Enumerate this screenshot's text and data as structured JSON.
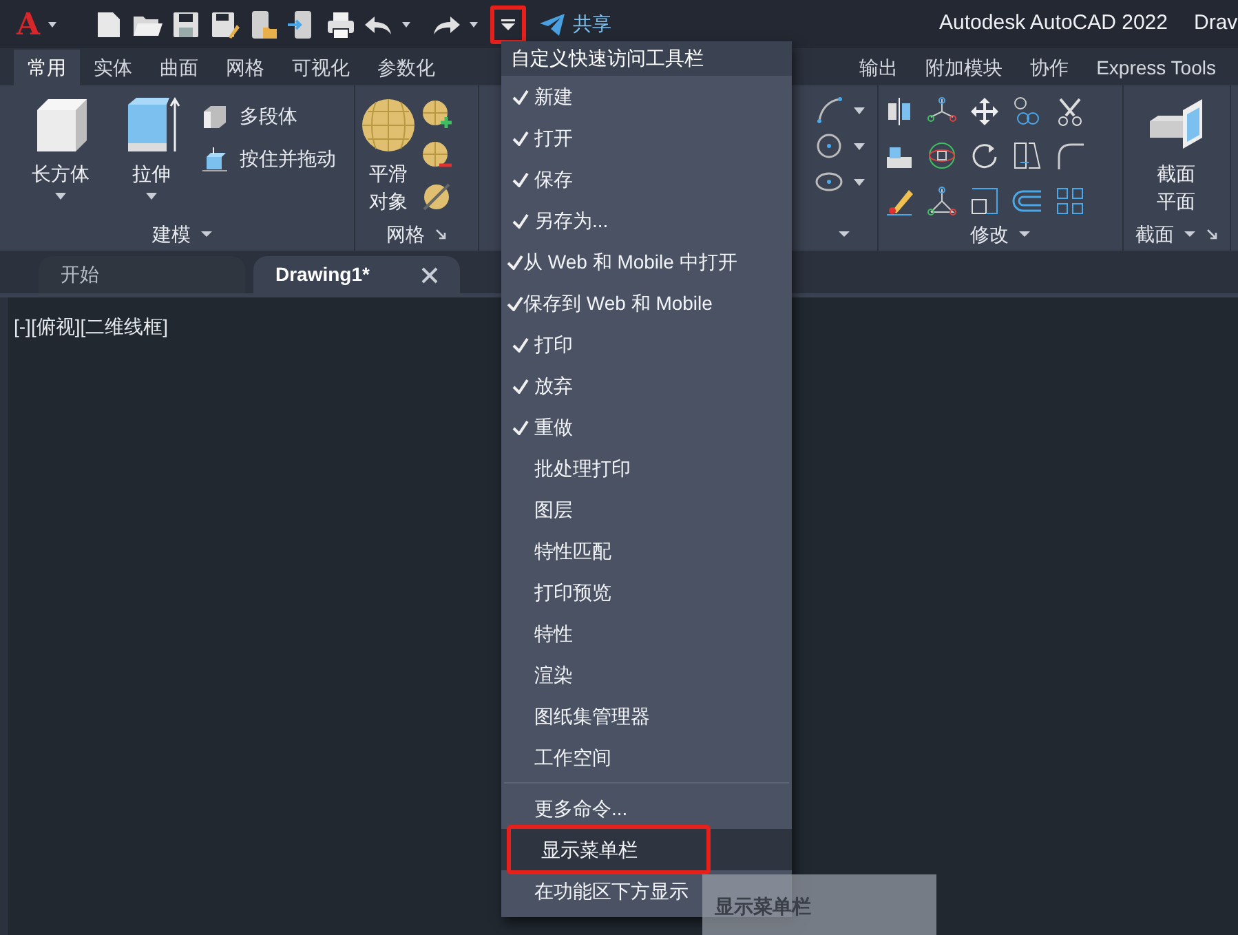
{
  "title_bar": {
    "logo_letter": "A",
    "share_label": "共享",
    "title": "Autodesk AutoCAD 2022",
    "title_cut": "Drav",
    "dropdown_highlighted": true
  },
  "ribbon_tabs": [
    {
      "label": "常用",
      "selected": true
    },
    {
      "label": "实体",
      "selected": false
    },
    {
      "label": "曲面",
      "selected": false
    },
    {
      "label": "网格",
      "selected": false
    },
    {
      "label": "可视化",
      "selected": false
    },
    {
      "label": "参数化",
      "selected": false
    },
    {
      "label": "输出",
      "selected": false
    },
    {
      "label": "附加模块",
      "selected": false
    },
    {
      "label": "协作",
      "selected": false
    },
    {
      "label": "Express Tools",
      "selected": false
    }
  ],
  "ribbon": {
    "modeling": {
      "title": "建模",
      "box": "长方体",
      "extrude": "拉伸",
      "polysolid": "多段体",
      "presspull": "按住并拖动"
    },
    "mesh": {
      "title": "网格",
      "smooth": "平滑对象"
    },
    "modify": {
      "title": "修改"
    },
    "section": {
      "title": "截面",
      "plane": "截面平面"
    }
  },
  "doc_tabs": [
    {
      "label": "开始",
      "selected": false
    },
    {
      "label": "Drawing1*",
      "selected": true
    }
  ],
  "viewport_label": "[-][俯视][二维线框]",
  "qat_menu": {
    "title": "自定义快速访问工具栏",
    "items": [
      {
        "kind": "command",
        "label": "新建",
        "checked": true,
        "selected": false,
        "highlighted": false
      },
      {
        "kind": "command",
        "label": "打开",
        "checked": true,
        "selected": false,
        "highlighted": false
      },
      {
        "kind": "command",
        "label": "保存",
        "checked": true,
        "selected": false,
        "highlighted": false
      },
      {
        "kind": "command",
        "label": "另存为...",
        "checked": true,
        "selected": false,
        "highlighted": false
      },
      {
        "kind": "command",
        "label": "从 Web 和 Mobile 中打开",
        "checked": true,
        "selected": false,
        "highlighted": false
      },
      {
        "kind": "command",
        "label": "保存到 Web 和 Mobile",
        "checked": true,
        "selected": false,
        "highlighted": false
      },
      {
        "kind": "command",
        "label": "打印",
        "checked": true,
        "selected": false,
        "highlighted": false
      },
      {
        "kind": "command",
        "label": "放弃",
        "checked": true,
        "selected": false,
        "highlighted": false
      },
      {
        "kind": "command",
        "label": "重做",
        "checked": true,
        "selected": false,
        "highlighted": false
      },
      {
        "kind": "command",
        "label": "批处理打印",
        "checked": false,
        "selected": false,
        "highlighted": false
      },
      {
        "kind": "command",
        "label": "图层",
        "checked": false,
        "selected": false,
        "highlighted": false
      },
      {
        "kind": "command",
        "label": "特性匹配",
        "checked": false,
        "selected": false,
        "highlighted": false
      },
      {
        "kind": "command",
        "label": "打印预览",
        "checked": false,
        "selected": false,
        "highlighted": false
      },
      {
        "kind": "command",
        "label": "特性",
        "checked": false,
        "selected": false,
        "highlighted": false
      },
      {
        "kind": "command",
        "label": "渲染",
        "checked": false,
        "selected": false,
        "highlighted": false
      },
      {
        "kind": "command",
        "label": "图纸集管理器",
        "checked": false,
        "selected": false,
        "highlighted": false
      },
      {
        "kind": "command",
        "label": "工作空间",
        "checked": false,
        "selected": false,
        "highlighted": false
      },
      {
        "kind": "separator"
      },
      {
        "kind": "command",
        "label": "更多命令...",
        "checked": false,
        "selected": false,
        "highlighted": false
      },
      {
        "kind": "command",
        "label": "显示菜单栏",
        "checked": false,
        "selected": true,
        "highlighted": true
      },
      {
        "kind": "command",
        "label": "在功能区下方显示",
        "checked": false,
        "selected": false,
        "highlighted": false
      }
    ]
  },
  "tooltip": {
    "text": "显示菜单栏"
  }
}
